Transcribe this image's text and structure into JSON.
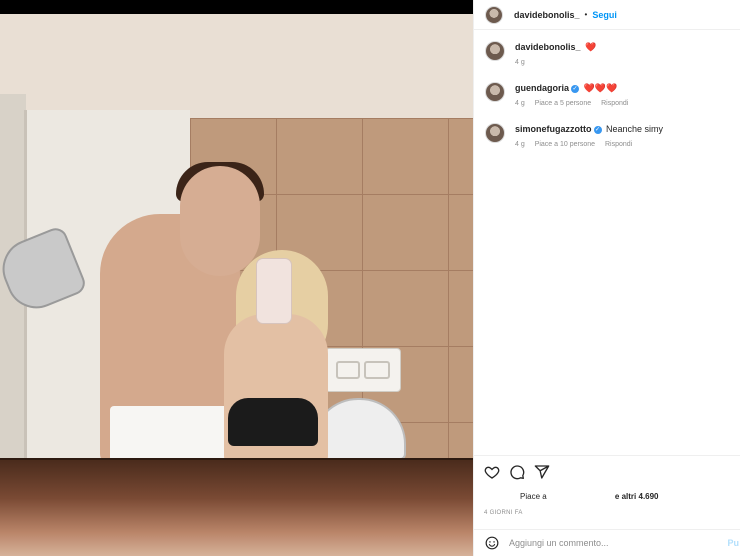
{
  "post": {
    "username": "davidebonolis_",
    "separator": "•",
    "follow_label": "Segui"
  },
  "comments": [
    {
      "user": "davidebonolis_",
      "text": "❤️",
      "time": "4 g",
      "likes": "",
      "reply": "",
      "verified": false
    },
    {
      "user": "guendagoria",
      "text": "❤️❤️❤️",
      "time": "4 g",
      "likes": "Piace a 5 persone",
      "reply": "Rispondi",
      "verified": true
    },
    {
      "user": "simonefugazzotto",
      "text": "Neanche simy",
      "time": "4 g",
      "likes": "Piace a 10 persone",
      "reply": "Rispondi",
      "verified": true
    }
  ],
  "likes_summary": {
    "prefix": "Piace a",
    "suffix": "e altri 4.690"
  },
  "post_date": "4 GIORNI FA",
  "comment_input": {
    "placeholder": "Aggiungi un commento...",
    "publish_label": "Pu"
  },
  "icons": [
    "heart-icon",
    "comment-icon",
    "share-icon",
    "emoji-icon"
  ],
  "colors": {
    "accent": "#0095f6",
    "verified": "#3897f0",
    "heart": "#ed4956",
    "muted": "#8e8e8e"
  }
}
